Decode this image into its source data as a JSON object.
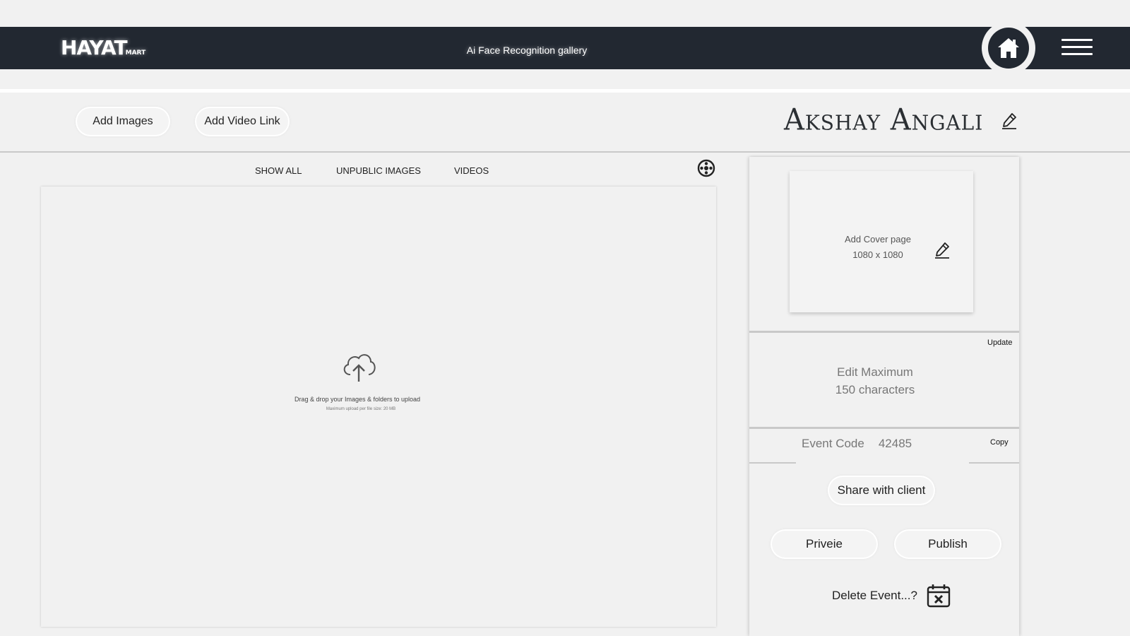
{
  "header": {
    "logo_text": "HAYAT",
    "logo_sub": "MART",
    "title": "Ai Face Recognition gallery",
    "home_icon": "home-icon",
    "menu_icon": "hamburger-menu-icon"
  },
  "toolbar": {
    "add_images_label": "Add Images",
    "add_video_label": "Add Video Link",
    "event_name": "Akshay  Angali"
  },
  "tabs": [
    {
      "label": "SHOW ALL"
    },
    {
      "label": "UNPUBLIC IMAGES"
    },
    {
      "label": "VIDEOS"
    }
  ],
  "upload": {
    "title": "Drag & drop your Images & folders to upload",
    "subtitle": "Maximum upload  per file size: 20 MB"
  },
  "panel": {
    "cover_line1": "Add Cover page",
    "cover_line2": "1080 x 1080",
    "update_label": "Update",
    "desc_line1": "Edit Maximum",
    "desc_line2": "150 characters",
    "event_code_label": "Event Code",
    "event_code_value": "42485",
    "copy_label": "Copy",
    "share_label": "Share with client",
    "preview_label": "Priveie",
    "publish_label": "Publish",
    "delete_label": "Delete Event...?"
  },
  "colors": {
    "header_bg": "#222831",
    "page_bg": "#f1f1f1"
  }
}
